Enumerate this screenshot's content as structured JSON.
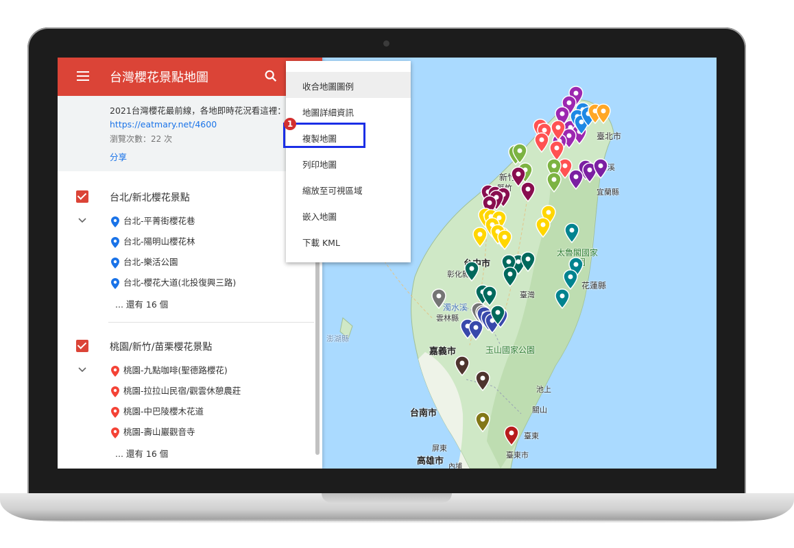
{
  "panel": {
    "title": "台灣櫻花景點地圖",
    "description_text": "2021台灣櫻花最前線，各地即時花況看這裡：",
    "description_link": "https://eatmary.net/4600",
    "views": "瀏覽次數：22 次",
    "share": "分享"
  },
  "layers": [
    {
      "title": "台北/新北櫻花景點",
      "pin_color": "#1a73e8",
      "items": [
        "台北-平菁街櫻花巷",
        "台北-陽明山櫻花林",
        "台北-樂活公園",
        "台北-櫻花大道(北投復興三路)"
      ],
      "more": "... 還有 16 個"
    },
    {
      "title": "桃園/新竹/苗栗櫻花景點",
      "pin_color": "#f44336",
      "items": [
        "桃園-九點咖啡(聖德路櫻花)",
        "桃園-拉拉山民宿/觀雲休憩農莊",
        "桃園-中巴陵櫻木花道",
        "桃園-壽山巖觀音寺"
      ],
      "more": "... 還有 16 個"
    }
  ],
  "menu": {
    "items": [
      "收合地圖圖例",
      "地圖詳細資訊",
      "複製地圖",
      "列印地圖",
      "縮放至可視區域",
      "嵌入地圖",
      "下載 KML"
    ],
    "active_index": 0,
    "highlight_index": 2
  },
  "annotation": {
    "badge": "1"
  },
  "map": {
    "labels": {
      "taipei": "臺北市",
      "hsinchu": "新竹市",
      "hsinchu_county": "縣竹",
      "yilan": "宜蘭縣",
      "yilan_coast": "礁溪",
      "taichung": "台中市",
      "changhua": "彰化縣",
      "taroko": "太魯閣國家公園",
      "nantou": "臺灣",
      "hualien": "花蓮縣",
      "zhuoshui": "濁水溪",
      "yunlin": "雲林縣",
      "penghu": "澎湖縣",
      "chiayi": "嘉義市",
      "yushan": "玉山國家公園",
      "chishang": "池上",
      "guanshan": "關山",
      "tainan": "台南市",
      "taitung_area": "臺東",
      "taitung": "臺東市",
      "pingtung": "屏東",
      "neipu": "內埔",
      "kaohsiung": "高雄市"
    }
  }
}
